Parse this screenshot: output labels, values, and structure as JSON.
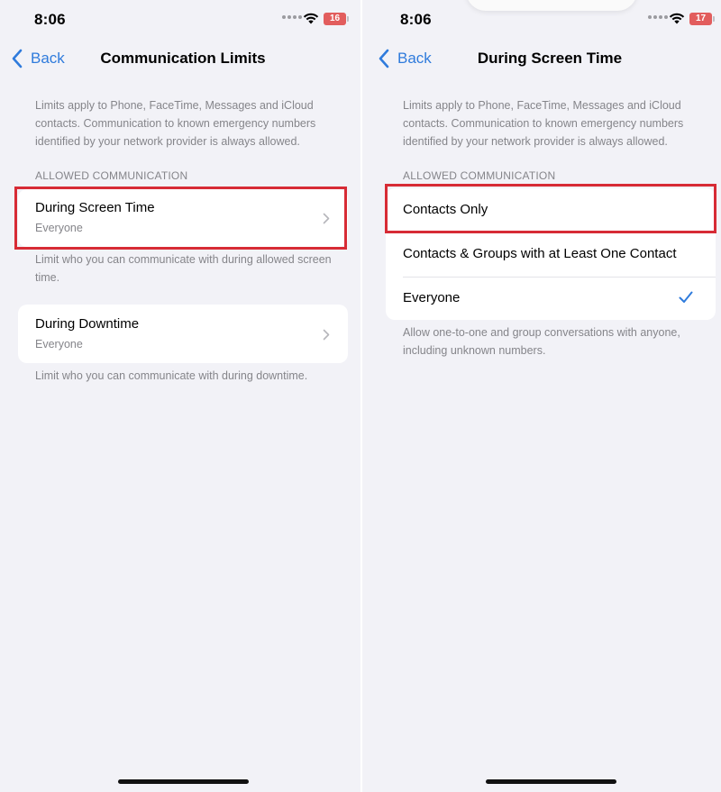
{
  "left": {
    "status": {
      "time": "8:06",
      "battery": "16"
    },
    "nav": {
      "back_label": "Back",
      "title": "Communication Limits"
    },
    "description": "Limits apply to Phone, FaceTime, Messages and iCloud contacts. Communication to known emergency numbers identified by your network provider is always allowed.",
    "section_header": "ALLOWED COMMUNICATION",
    "items": [
      {
        "title": "During Screen Time",
        "value": "Everyone",
        "footer": "Limit who you can communicate with during allowed screen time."
      },
      {
        "title": "During Downtime",
        "value": "Everyone",
        "footer": "Limit who you can communicate with during downtime."
      }
    ]
  },
  "right": {
    "status": {
      "time": "8:06",
      "battery": "17"
    },
    "nav": {
      "back_label": "Back",
      "title": "During Screen Time"
    },
    "description": "Limits apply to Phone, FaceTime, Messages and iCloud contacts. Communication to known emergency numbers identified by your network provider is always allowed.",
    "section_header": "ALLOWED COMMUNICATION",
    "options": [
      {
        "label": "Contacts Only",
        "selected": false
      },
      {
        "label": "Contacts & Groups with at Least One Contact",
        "selected": false
      },
      {
        "label": "Everyone",
        "selected": true
      }
    ],
    "footer": "Allow one-to-one and group conversations with anyone, including unknown numbers."
  },
  "colors": {
    "accent": "#2f7bdc",
    "highlight": "#d72b35",
    "battery": "#e25d5d",
    "background": "#f2f2f7"
  },
  "icons": [
    "back-chevron-icon",
    "wifi-icon",
    "battery-icon",
    "chevron-right-icon",
    "checkmark-icon"
  ]
}
